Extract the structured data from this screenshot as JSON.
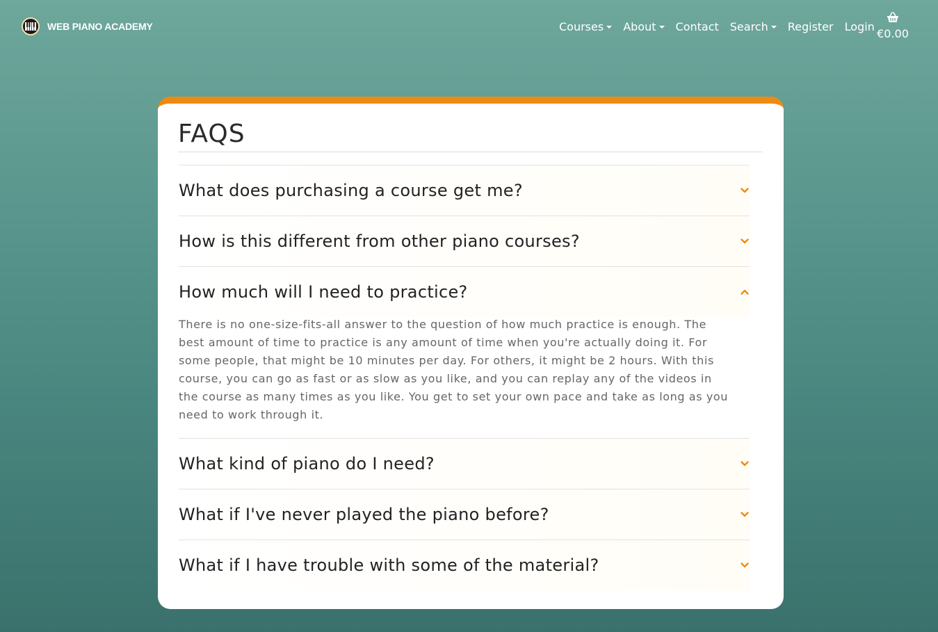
{
  "nav": {
    "brand": "WEB PIANO ACADEMY",
    "logo_icon": "piano-keys-icon",
    "items": [
      {
        "label": "Courses",
        "dropdown": true
      },
      {
        "label": "About",
        "dropdown": true
      },
      {
        "label": "Contact",
        "dropdown": false
      },
      {
        "label": "Search",
        "dropdown": true
      },
      {
        "label": "Register",
        "dropdown": false
      },
      {
        "label": "Login",
        "dropdown": false
      }
    ],
    "cart_icon": "shopping-basket-icon",
    "cart_total": "€0.00"
  },
  "faq": {
    "title": "FAQS",
    "accent_color": "#ee8a12",
    "items": [
      {
        "question": "What does purchasing a course get me?",
        "expanded": false
      },
      {
        "question": "How is this different from other piano courses?",
        "expanded": false
      },
      {
        "question": "How much will I need to practice?",
        "expanded": true,
        "answer": "There is no one-size-fits-all answer to the question of how much practice is enough. The best amount of time to practice is any amount of time when you're actually doing it. For some people, that might be 10 minutes per day. For others, it might be 2 hours. With this course, you can go as fast or as slow as you like, and you can replay any of the videos in the course as many times as you like. You get to set your own pace and take as long as you need to work through it."
      },
      {
        "question": "What kind of piano do I need?",
        "expanded": false
      },
      {
        "question": "What if I've never played the piano before?",
        "expanded": false
      },
      {
        "question": "What if I have trouble with some of the material?",
        "expanded": false
      }
    ]
  }
}
